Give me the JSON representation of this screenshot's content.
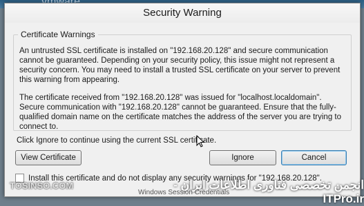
{
  "background": {
    "app_name": "vmware"
  },
  "dialog": {
    "title": "Security Warning",
    "group_title": "Certificate Warnings",
    "paragraph_1": "An untrusted SSL certificate is installed on \"192.168.20.128\" and secure communication cannot be guaranteed.  Depending on your security policy, this issue might not represent a security concern.  You may need to install a trusted SSL certificate on your server to prevent this warning from appearing.",
    "paragraph_2": "The certificate received from \"192.168.20.128\" was issued for \"localhost.localdomain\".  Secure communication with \"192.168.20.128\" cannot be guaranteed.  Ensure that the fully-qualified domain name on the certificate matches the address of the server you are trying to connect to.",
    "ignore_instruction": "Click Ignore to continue using the current SSL certificate.",
    "buttons": {
      "view_certificate": "View Certificate",
      "ignore": "Ignore",
      "cancel": "Cancel"
    },
    "checkbox_label": "Install this certificate and do not display any security warnings for \"192.168.20.128\"."
  },
  "watermark": {
    "left": "TOSINSO.COM",
    "right": "انجمن تخصصی فناوری اطلاعات ایران - ITPro.ir",
    "bottom": "Windows Session Credentials"
  },
  "colors": {
    "default_button_border": "#3c7fb1",
    "dialog_bg": "#f0f0f0"
  }
}
